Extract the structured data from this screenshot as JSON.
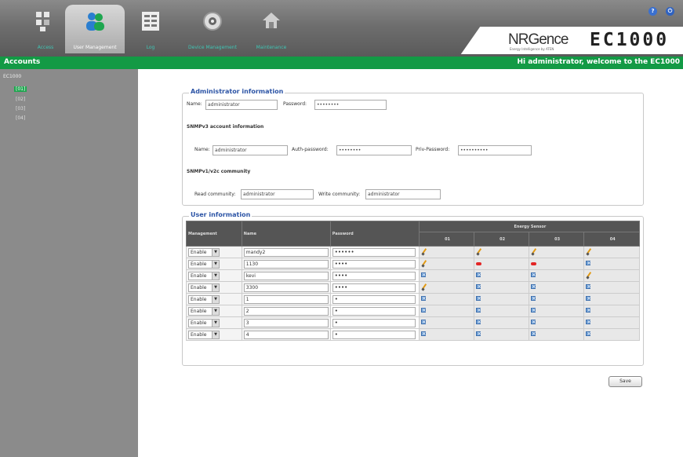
{
  "nav": {
    "tabs": [
      {
        "label": "Access"
      },
      {
        "label": "User Management"
      },
      {
        "label": "Log"
      },
      {
        "label": "Device Management"
      },
      {
        "label": "Maintenance"
      }
    ]
  },
  "brand": {
    "logo": "NRGence",
    "logo_sub": "Energy Intelligence by ATEN",
    "product": "EC1000"
  },
  "header": {
    "section_title": "Accounts",
    "welcome": "Hi administrator, welcome to the EC1000"
  },
  "sidebar": {
    "root": "EC1000",
    "items": [
      "[01]",
      "[02]",
      "[03]",
      "[04]"
    ]
  },
  "admin": {
    "legend": "Administrator information",
    "name_label": "Name:",
    "name_value": "administrator",
    "password_label": "Password:",
    "password_value": "••••••••",
    "snmpv3_title": "SNMPv3 account information",
    "snmp_name_label": "Name:",
    "snmp_name_value": "administrator",
    "auth_label": "Auth-password:",
    "auth_value": "••••••••",
    "priv_label": "Priv-Password:",
    "priv_value": "••••••••••",
    "snmpv1_title": "SNMPv1/v2c community",
    "read_label": "Read community:",
    "read_value": "administrator",
    "write_label": "Write community:",
    "write_value": "administrator"
  },
  "users": {
    "legend": "User information",
    "col_management": "Management",
    "col_name": "Name",
    "col_password": "Password",
    "col_energy": "Energy Sensor",
    "sensors": [
      "01",
      "02",
      "03",
      "04"
    ],
    "rows": [
      {
        "mgmt": "Enable",
        "name": "mandy2",
        "pw": "••••••",
        "es": [
          "pencil",
          "pencil",
          "pencil",
          "pencil"
        ]
      },
      {
        "mgmt": "Enable",
        "name": "1130",
        "pw": "••••",
        "es": [
          "pencil",
          "red",
          "red",
          "x"
        ]
      },
      {
        "mgmt": "Enable",
        "name": "kevi",
        "pw": "••••",
        "es": [
          "x",
          "x",
          "x",
          "pencil"
        ]
      },
      {
        "mgmt": "Enable",
        "name": "3300",
        "pw": "••••",
        "es": [
          "pencil",
          "x",
          "x",
          "x"
        ]
      },
      {
        "mgmt": "Enable",
        "name": "1",
        "pw": "•",
        "es": [
          "x",
          "x",
          "x",
          "x"
        ]
      },
      {
        "mgmt": "Enable",
        "name": "2",
        "pw": "•",
        "es": [
          "x",
          "x",
          "x",
          "x"
        ]
      },
      {
        "mgmt": "Enable",
        "name": "3",
        "pw": "•",
        "es": [
          "x",
          "x",
          "x",
          "x"
        ]
      },
      {
        "mgmt": "Enable",
        "name": "4",
        "pw": "•",
        "es": [
          "x",
          "x",
          "x",
          "x"
        ]
      }
    ]
  },
  "actions": {
    "save_label": "Save"
  },
  "colors": {
    "accent_green": "#139a45",
    "legend_blue": "#2d55a6",
    "header_gray": "#555555"
  }
}
